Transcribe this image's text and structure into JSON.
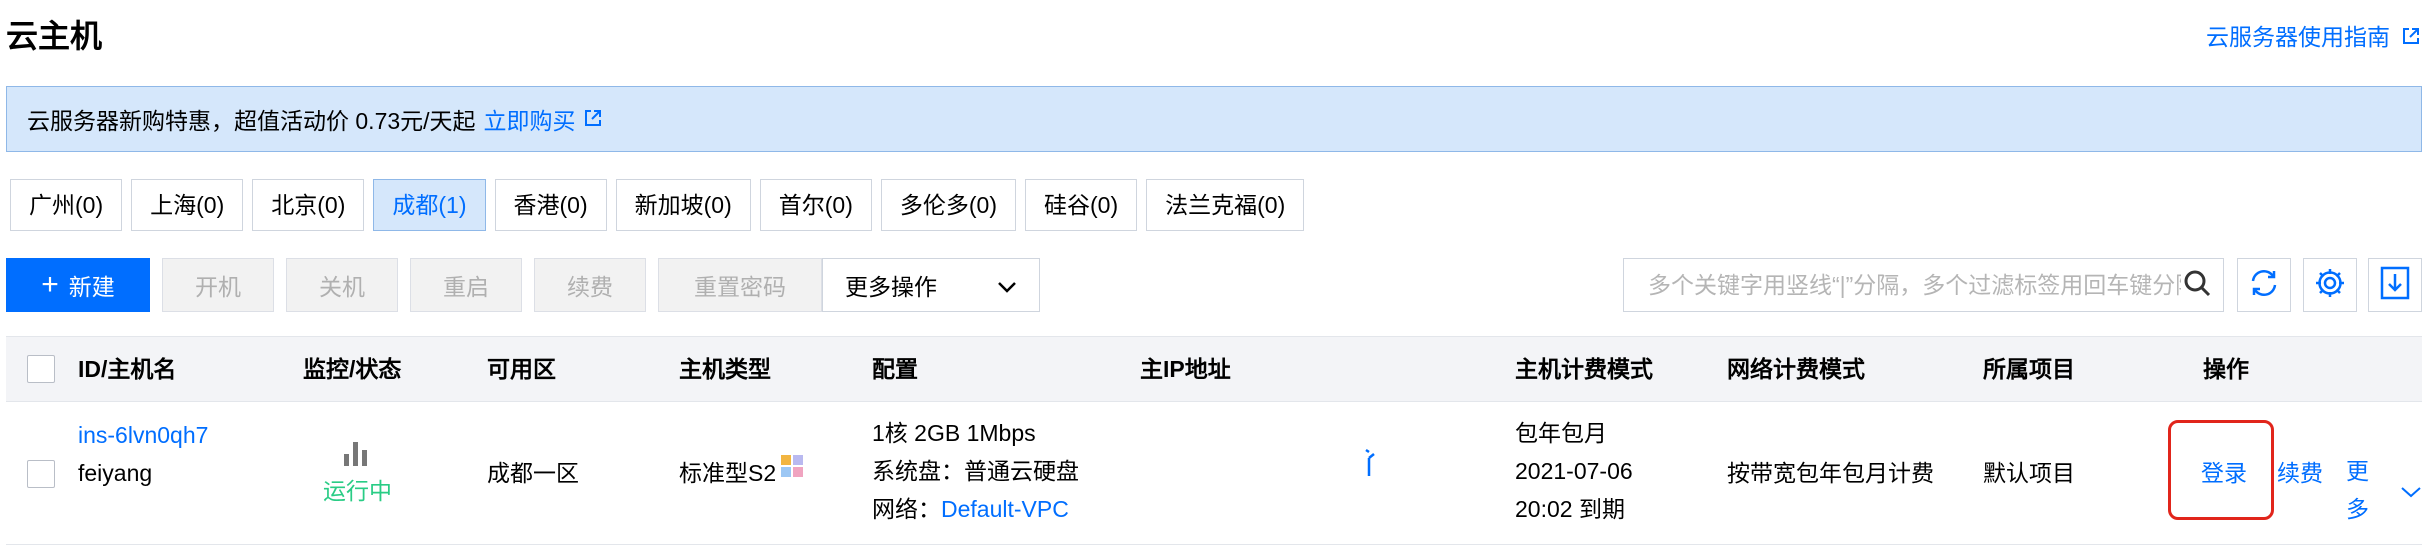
{
  "header": {
    "title": "云主机",
    "guide_link": "云服务器使用指南"
  },
  "banner": {
    "text": "云服务器新购特惠，超值活动价 0.73元/天起",
    "link": "立即购买"
  },
  "regions": [
    {
      "label": "广州(0)",
      "active": false
    },
    {
      "label": "上海(0)",
      "active": false
    },
    {
      "label": "北京(0)",
      "active": false
    },
    {
      "label": "成都(1)",
      "active": true
    },
    {
      "label": "香港(0)",
      "active": false
    },
    {
      "label": "新加坡(0)",
      "active": false
    },
    {
      "label": "首尔(0)",
      "active": false
    },
    {
      "label": "多伦多(0)",
      "active": false
    },
    {
      "label": "硅谷(0)",
      "active": false
    },
    {
      "label": "法兰克福(0)",
      "active": false
    }
  ],
  "toolbar": {
    "new_label": "新建",
    "power_on_label": "开机",
    "power_off_label": "关机",
    "restart_label": "重启",
    "renew_label": "续费",
    "reset_password_label": "重置密码",
    "more_actions_label": "更多操作",
    "search_placeholder": "多个关键字用竖线“|”分隔，多个过滤标签用回车键分隔"
  },
  "table": {
    "columns": {
      "id": "ID/主机名",
      "monitor": "监控/状态",
      "zone": "可用区",
      "type": "主机类型",
      "config": "配置",
      "ip": "主IP地址",
      "billing": "主机计费模式",
      "network_billing": "网络计费模式",
      "project": "所属项目",
      "actions": "操作"
    },
    "rows": [
      {
        "instance_id": "ins-6lvn0qh7",
        "hostname": "feiyang",
        "status": "运行中",
        "zone": "成都一区",
        "type": "标准型S2",
        "config_line1": "1核 2GB 1Mbps",
        "config_line2": "系统盘：普通云硬盘",
        "config_network_label": "网络：",
        "config_network_link": "Default-VPC",
        "billing_mode": "包年包月",
        "expire_date": "2021-07-06",
        "expire_time": "20:02 到期",
        "network_billing": "按带宽包年包月计费",
        "project": "默认项目",
        "action_login": "登录",
        "action_renew": "续费",
        "action_more": "更多"
      }
    ]
  },
  "colors": {
    "accent": "#006eff",
    "banner_bg": "#d5e7fb",
    "status_running": "#29cc85",
    "highlight": "#e1251b"
  }
}
